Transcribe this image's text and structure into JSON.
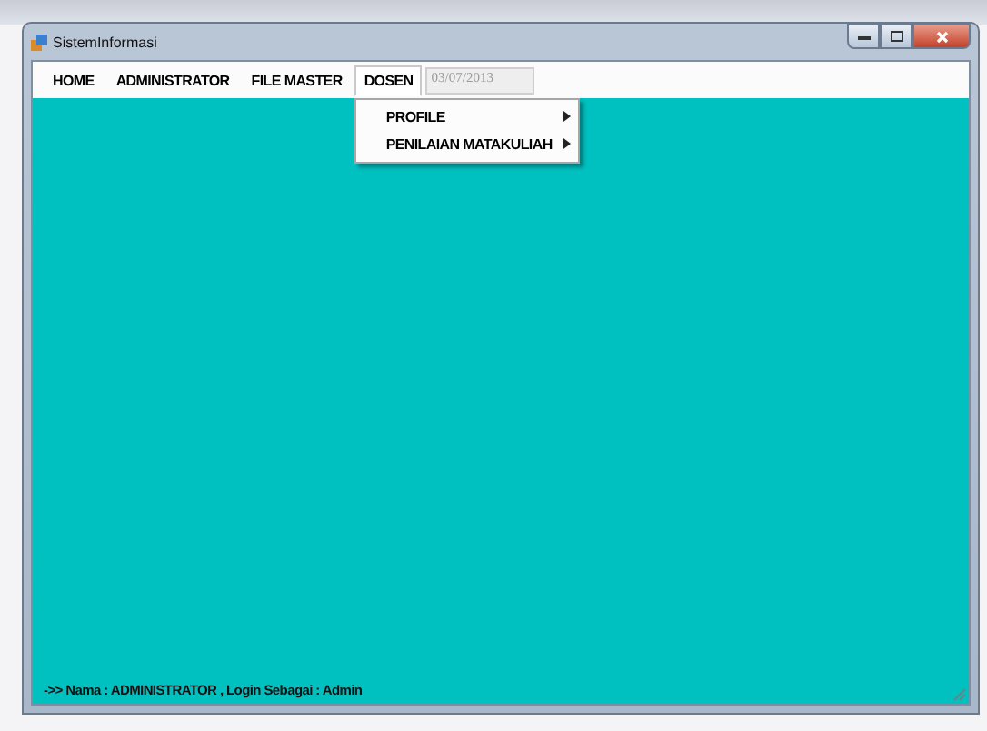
{
  "window": {
    "title": "SistemInformasi"
  },
  "menu": [
    {
      "label": "HOME",
      "selected": false
    },
    {
      "label": "ADMINISTRATOR",
      "selected": false
    },
    {
      "label": "FILE MASTER",
      "selected": false
    },
    {
      "label": "DOSEN",
      "selected": true
    }
  ],
  "date_field": {
    "value": "03/07/2013",
    "disabled": true
  },
  "dropdown": [
    {
      "label": "PROFILE",
      "has_submenu": true
    },
    {
      "label": "PENILAIAN MATAKULIAH",
      "has_submenu": true
    }
  ],
  "status_bar": "->> Nama : ADMINISTRATOR , Login Sebagai : Admin"
}
